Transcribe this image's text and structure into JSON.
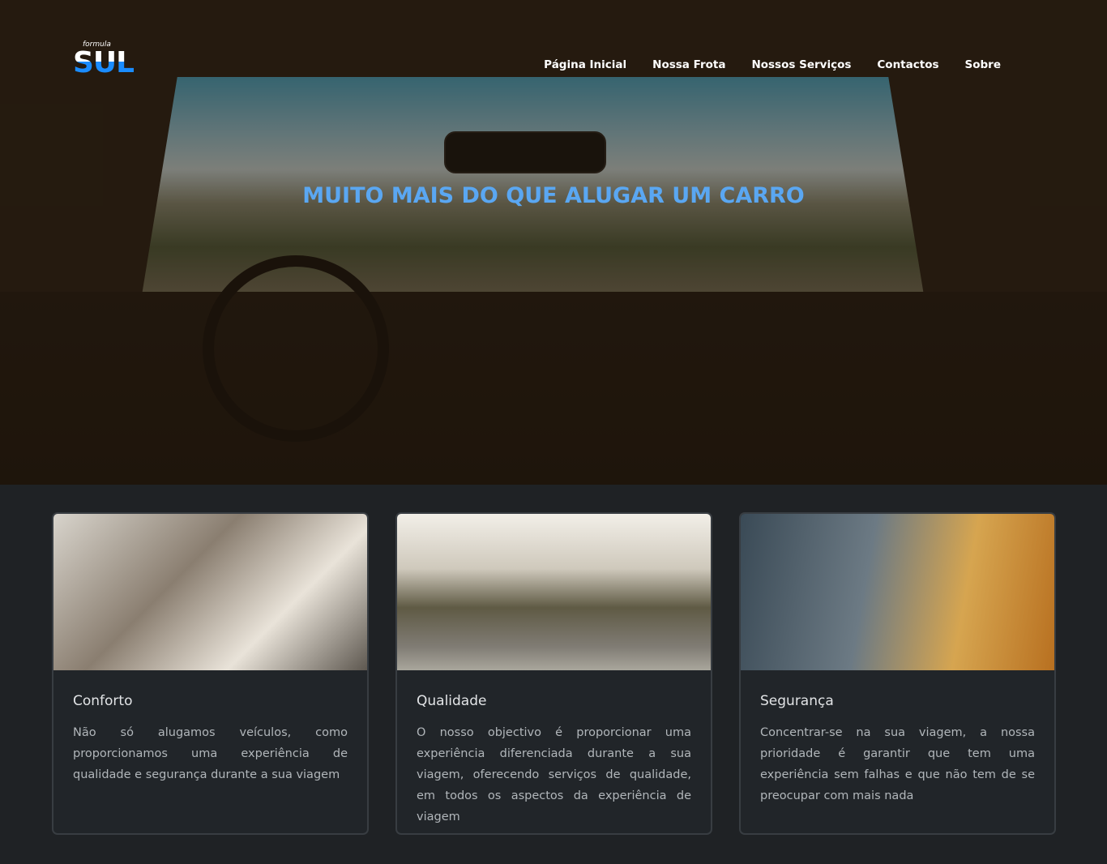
{
  "logo": {
    "small": "formula",
    "big": "SUL"
  },
  "nav": [
    {
      "label": "Página Inicial"
    },
    {
      "label": "Nossa Frota"
    },
    {
      "label": "Nossos Serviços"
    },
    {
      "label": "Contactos"
    },
    {
      "label": "Sobre"
    }
  ],
  "hero": {
    "headline": "MUITO MAIS DO QUE ALUGAR UM CARRO"
  },
  "cards": [
    {
      "title": "Conforto",
      "text": "Não só alugamos veículos, como proporcionamos uma experiência de qualidade e segurança durante a sua viagem"
    },
    {
      "title": "Qualidade",
      "text": "O nosso objectivo é proporcionar uma experiência diferenciada durante a sua viagem, oferecendo serviços de qualidade, em todos os aspectos da experiência de viagem"
    },
    {
      "title": "Segurança",
      "text": "Concentrar-se na sua viagem, a nossa prioridade é garantir que tem uma experiência sem falhas e que não tem de se preocupar com mais nada"
    }
  ],
  "colors": {
    "accent": "#1a8cff",
    "headline": "#5aa7f2",
    "card_bg": "#212529"
  }
}
